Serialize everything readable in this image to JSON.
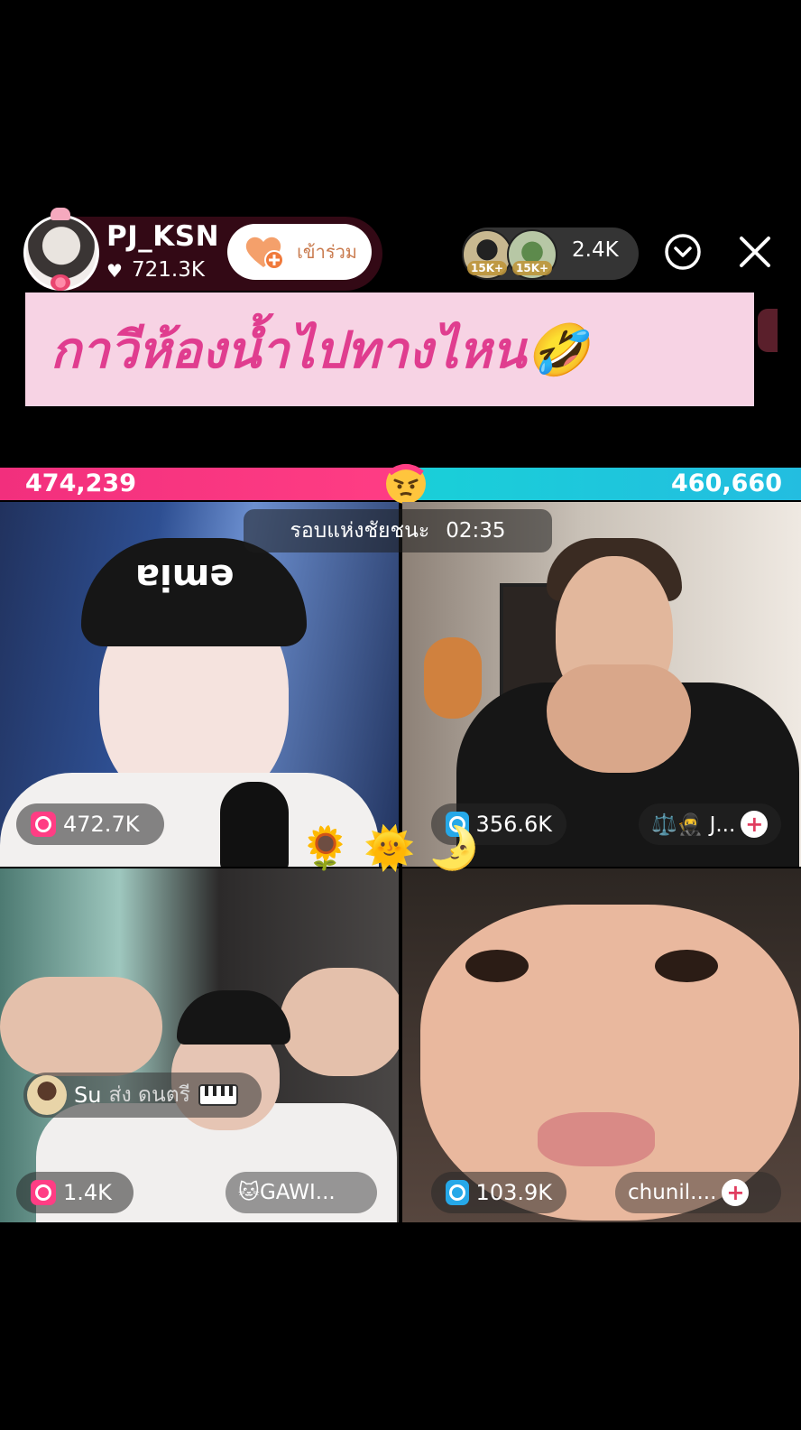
{
  "header": {
    "host_name": "PJ_KSN",
    "host_likes": "721.3K",
    "join_label": "เข้าร่วม",
    "viewer_badges": [
      "15K+",
      "15K+"
    ],
    "viewer_count": "2.4K"
  },
  "caption": {
    "text": "กาวีห้องน้ำไปทางไหน🤣"
  },
  "battle": {
    "score_left": "474,239",
    "score_right": "460,660",
    "round_label": "รอบแห่งชัยชนะ",
    "timer": "02:35"
  },
  "tiles": [
    {
      "count": "472.7K",
      "name": ""
    },
    {
      "count": "356.6K",
      "name": "⚖️🥷 J..."
    },
    {
      "count": "1.4K",
      "name": "🐱GAWI..."
    },
    {
      "count": "103.9K",
      "name": "chunil...."
    }
  ],
  "gift": {
    "user": "Su",
    "action": "ส่ง ดนตรี"
  },
  "emojis": [
    "🌻",
    "🌞",
    "🌛"
  ],
  "colors": {
    "team_left": "#f22f7d",
    "team_right": "#19d0d8",
    "caption_bg": "#f7d3e4",
    "caption_text": "#e03d8f"
  },
  "icons": {
    "close": "close-icon",
    "collapse": "chevron-down-icon",
    "like": "heart-icon",
    "add": "plus-icon",
    "gift": "piano-gift-icon"
  }
}
